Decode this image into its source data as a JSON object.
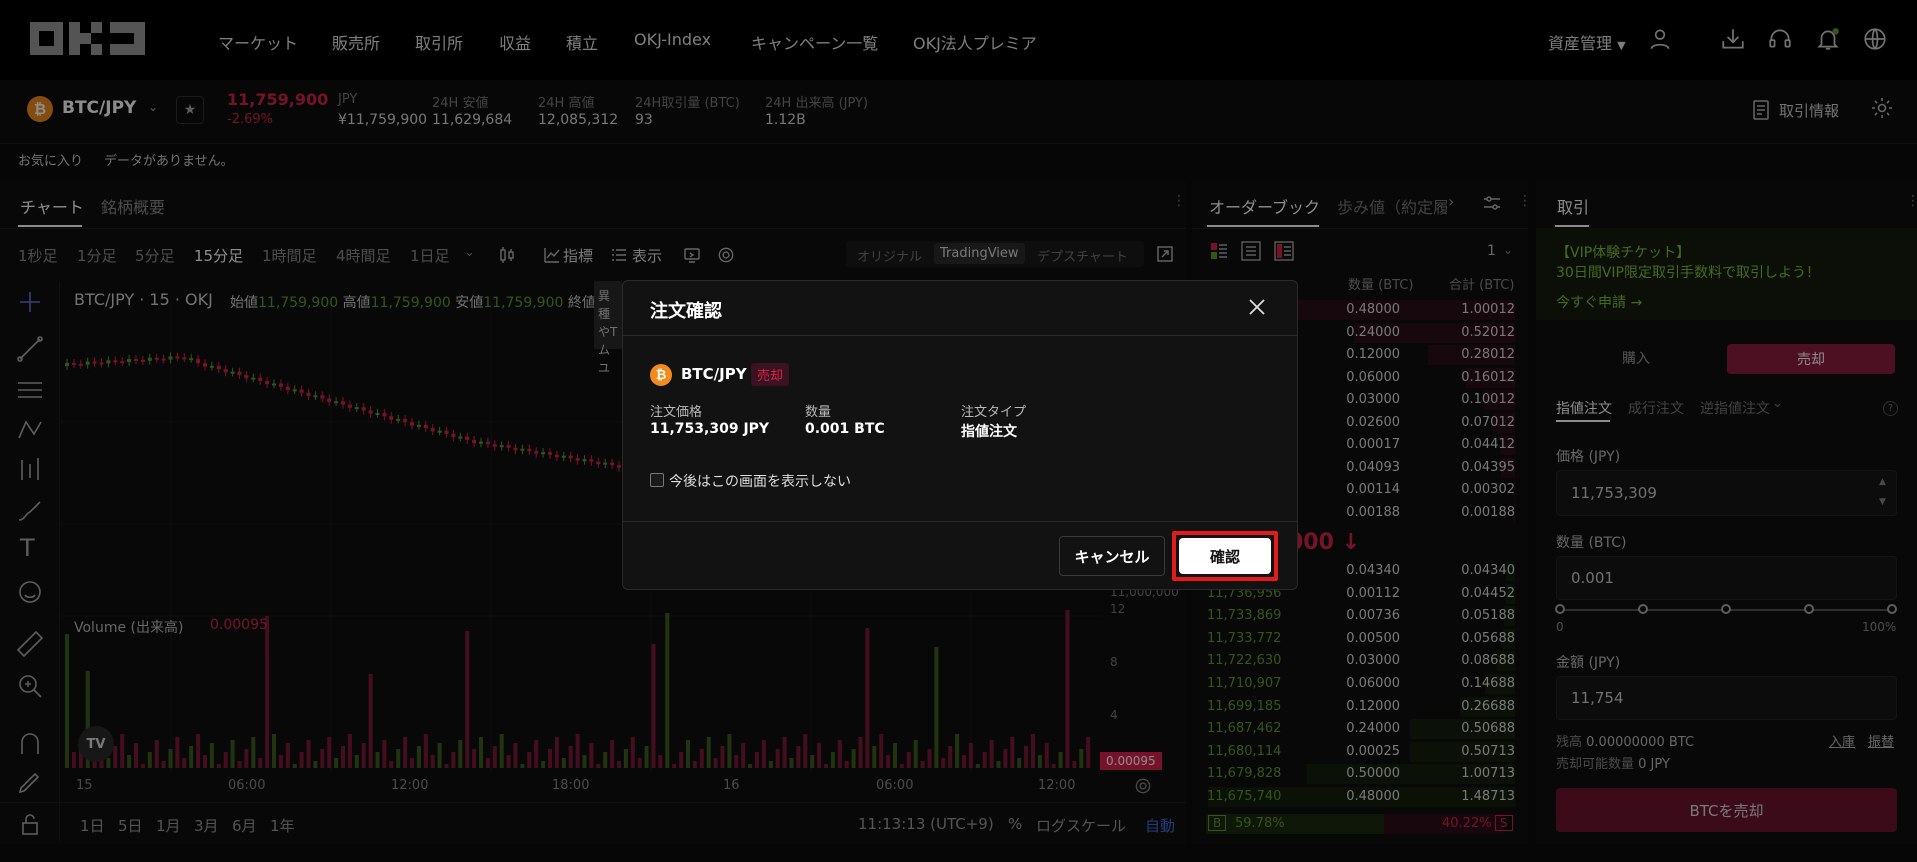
{
  "nav": {
    "logo_alt": "OKJ",
    "items": [
      "マーケット",
      "販売所",
      "取引所",
      "収益",
      "積立",
      "OKJ-Index",
      "キャンペーン一覧",
      "OKJ法人プレミア"
    ],
    "asset_menu": "資産管理"
  },
  "ticker": {
    "pair": "BTC/JPY",
    "price": "11,759,900",
    "change": "-2.69%",
    "jpy_label": "JPY",
    "jpy_value": "¥11,759,900",
    "low_label": "24H 安値",
    "low_value": "11,629,684",
    "high_label": "24H 高値",
    "high_value": "12,085,312",
    "vol_btc_label": "24H取引量 (BTC)",
    "vol_btc_value": "93",
    "vol_jpy_label": "24H 出来高 (JPY)",
    "vol_jpy_value": "1.12B",
    "trade_info": "取引情報"
  },
  "favorites": {
    "label": "お気に入り",
    "empty": "データがありません。"
  },
  "chart": {
    "tabs": [
      "チャート",
      "銘柄概要"
    ],
    "timeframes": [
      "1秒足",
      "1分足",
      "5分足",
      "15分足",
      "1時間足",
      "4時間足",
      "1日足"
    ],
    "active_timeframe": "15分足",
    "indicator": "指標",
    "display": "表示",
    "views": [
      "オリジナル",
      "TradingView",
      "デプスチャート"
    ],
    "title": "BTC/JPY · 15 · OKJ",
    "ohlc": [
      {
        "label": "始値",
        "value": "11,759,900"
      },
      {
        "label": "高値",
        "value": "11,759,900"
      },
      {
        "label": "安値",
        "value": "11,759,900"
      },
      {
        "label": "終値",
        "value": ""
      }
    ],
    "tooltip_lines": [
      "異種",
      "やT",
      "ムユ"
    ],
    "price_axis": [
      "11,000,000"
    ],
    "volume_label": "Volume (出来高)",
    "volume_value": "0.00095",
    "volume_axis": [
      "12",
      "8",
      "4"
    ],
    "volume_tag": "0.00095",
    "time_axis": [
      "15",
      "06:00",
      "12:00",
      "18:00",
      "16",
      "06:00",
      "12:00"
    ],
    "ranges": [
      "1日",
      "5日",
      "1月",
      "3月",
      "6月",
      "1年"
    ],
    "clock": "11:13:13 (UTC+9)",
    "percent": "%",
    "logscale": "ログスケール",
    "auto": "自動",
    "tv_badge": "TV"
  },
  "orderbook": {
    "tabs": [
      "オーダーブック",
      "歩み値（約定履"
    ],
    "precision": "1",
    "col_qty": "数量 (BTC)",
    "col_total": "合計 (BTC)",
    "asks": [
      {
        "qty": "0.48000",
        "total": "1.00012"
      },
      {
        "qty": "0.24000",
        "total": "0.52012"
      },
      {
        "qty": "0.12000",
        "total": "0.28012"
      },
      {
        "qty": "0.06000",
        "total": "0.16012"
      },
      {
        "qty": "0.03000",
        "total": "0.10012"
      },
      {
        "qty": "0.02600",
        "total": "0.07012"
      },
      {
        "qty": "0.00017",
        "total": "0.04412"
      },
      {
        "qty": "0.04093",
        "total": "0.04395"
      },
      {
        "qty": "0.00114",
        "total": "0.00302"
      },
      {
        "qty": "0.00188",
        "total": "0.00188"
      }
    ],
    "mid_fragment": "000 ↓",
    "bids": [
      {
        "price": "",
        "qty": "0.04340",
        "total": "0.04340"
      },
      {
        "price": "11,736,956",
        "qty": "0.00112",
        "total": "0.04452"
      },
      {
        "price": "11,733,869",
        "qty": "0.00736",
        "total": "0.05188"
      },
      {
        "price": "11,733,772",
        "qty": "0.00500",
        "total": "0.05688"
      },
      {
        "price": "11,722,630",
        "qty": "0.03000",
        "total": "0.08688"
      },
      {
        "price": "11,710,907",
        "qty": "0.06000",
        "total": "0.14688"
      },
      {
        "price": "11,699,185",
        "qty": "0.12000",
        "total": "0.26688"
      },
      {
        "price": "11,687,462",
        "qty": "0.24000",
        "total": "0.50688"
      },
      {
        "price": "11,680,114",
        "qty": "0.00025",
        "total": "0.50713"
      },
      {
        "price": "11,679,828",
        "qty": "0.50000",
        "total": "1.00713"
      },
      {
        "price": "11,675,740",
        "qty": "0.48000",
        "total": "1.48713"
      }
    ],
    "buy_ratio": "59.78%",
    "sell_ratio": "40.22%",
    "buy_badge": "B",
    "sell_badge": "S"
  },
  "trade": {
    "tab": "取引",
    "promo_title": "【VIP体験チケット】",
    "promo_text": "30日間VIP限定取引手数料で取引しよう！",
    "promo_link": "今すぐ申請 →",
    "buy": "購入",
    "sell": "売却",
    "order_types": [
      "指値注文",
      "成行注文",
      "逆指値注文"
    ],
    "help": "?",
    "price_label": "価格 (JPY)",
    "price_value": "11,753,309",
    "qty_label": "数量 (BTC)",
    "qty_value": "0.001",
    "slider_min": "0",
    "slider_max": "100%",
    "amount_label": "金額 (JPY)",
    "amount_value": "11,754",
    "balance_label": "残高",
    "balance_value": "0.00000000 BTC",
    "deposit": "入庫",
    "transfer": "振替",
    "sellable_label": "売却可能数量",
    "sellable_value": "0 JPY",
    "submit": "BTCを売却"
  },
  "modal": {
    "title": "注文確認",
    "pair": "BTC/JPY",
    "side": "売却",
    "price_label": "注文価格",
    "price_value": "11,753,309 JPY",
    "qty_label": "数量",
    "qty_value": "0.001 BTC",
    "type_label": "注文タイプ",
    "type_value": "指値注文",
    "dont_show": "今後はこの画面を表示しない",
    "cancel": "キャンセル",
    "confirm": "確認"
  },
  "colors": {
    "accent_red": "#d8244e",
    "accent_green": "#5f9b2c",
    "sell_btn": "#8b1e3f",
    "highlight_box": "#e21b1b"
  }
}
